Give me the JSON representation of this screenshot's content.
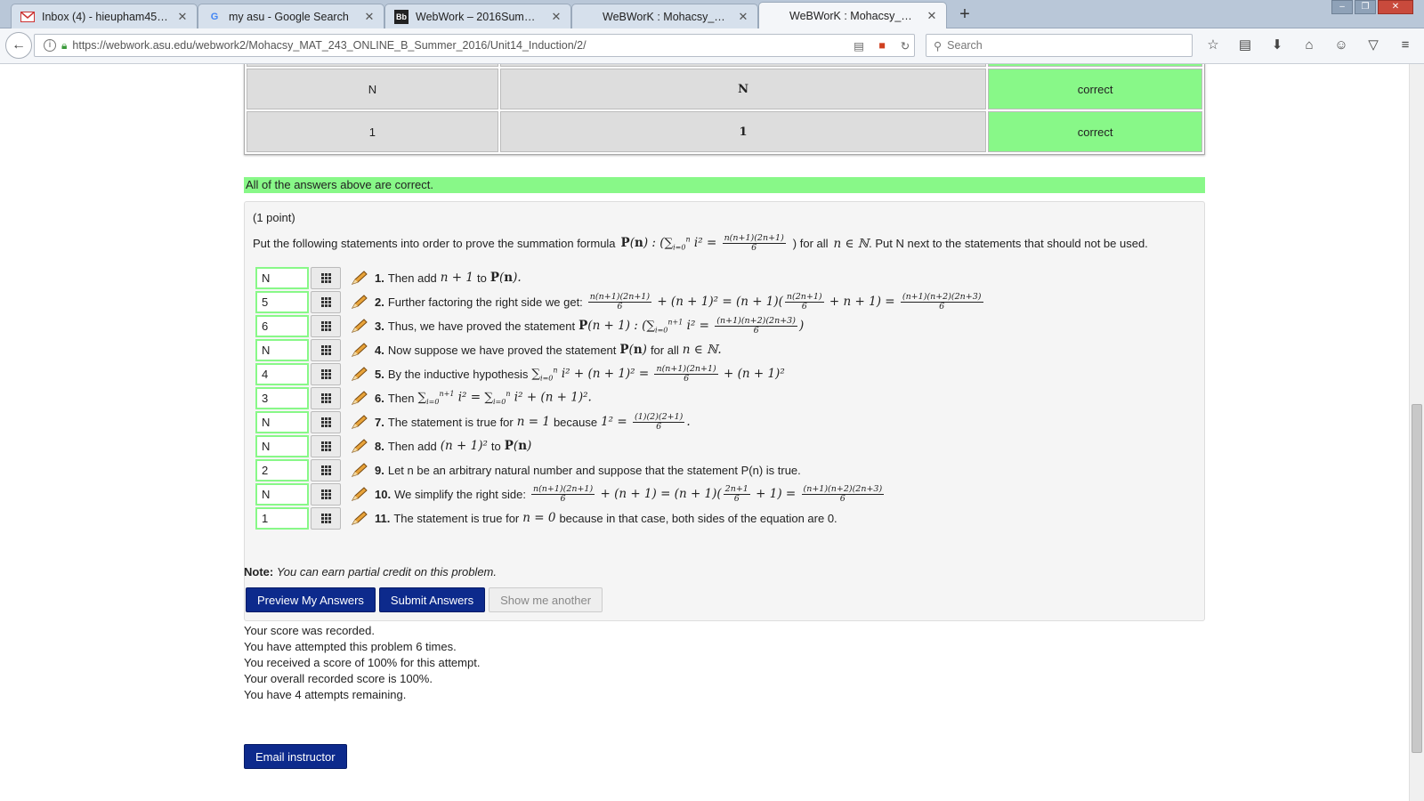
{
  "tabs": [
    {
      "title": "Inbox (4) - hieupham45@g...",
      "favicon": "gmail-icon"
    },
    {
      "title": "my asu - Google Search",
      "favicon": "google-icon"
    },
    {
      "title": "WebWork – 2016SummerB...",
      "favicon": "blackboard-icon"
    },
    {
      "title": "WeBWorK : Mohacsy_MAT...",
      "favicon": "none"
    },
    {
      "title": "WeBWorK : Mohacsy_MAT...",
      "favicon": "none"
    }
  ],
  "active_tab": 4,
  "url": "https://webwork.asu.edu/webwork2/Mohacsy_MAT_243_ONLINE_B_Summer_2016/Unit14_Induction/2/",
  "search_placeholder": "Search",
  "results_table": {
    "rows": [
      {
        "entered": "N",
        "preview": "N",
        "result": "correct"
      },
      {
        "entered": "1",
        "preview": "1",
        "result": "correct"
      }
    ]
  },
  "all_correct_message": "All of the answers above are correct.",
  "problem": {
    "points": "(1 point)",
    "intro_before": "Put the following statements into order to prove the summation formula",
    "intro_after": ") for all",
    "intro_end": ". Put N next to the statements that should not be used.",
    "statements": [
      {
        "num": "1.",
        "answer": "N",
        "text": "Then add n + 1 to P(n)."
      },
      {
        "num": "2.",
        "answer": "5",
        "text": "Further factoring the right side we get:"
      },
      {
        "num": "3.",
        "answer": "6",
        "text": "Thus, we have proved the statement"
      },
      {
        "num": "4.",
        "answer": "N",
        "text": "Now suppose we have proved the statement"
      },
      {
        "num": "5.",
        "answer": "4",
        "text": "By the inductive hypothesis"
      },
      {
        "num": "6.",
        "answer": "3",
        "text": "Then"
      },
      {
        "num": "7.",
        "answer": "N",
        "text": "The statement is true for"
      },
      {
        "num": "8.",
        "answer": "N",
        "text": "Then add"
      },
      {
        "num": "9.",
        "answer": "2",
        "text": "Let n be an arbitrary natural number and suppose that the statement P(n) is true."
      },
      {
        "num": "10.",
        "answer": "N",
        "text": "We simplify the right side:"
      },
      {
        "num": "11.",
        "answer": "1",
        "text": "The statement is true for"
      }
    ]
  },
  "note": {
    "label": "Note:",
    "text": "You can earn partial credit on this problem."
  },
  "buttons": {
    "preview": "Preview My Answers",
    "submit": "Submit Answers",
    "show_another": "Show me another"
  },
  "score_lines": [
    "Your score was recorded.",
    "You have attempted this problem 6 times.",
    "You received a score of 100% for this attempt.",
    "Your overall recorded score is 100%.",
    "You have 4 attempts remaining."
  ],
  "email_button": "Email instructor",
  "colors": {
    "correct": "#88f888",
    "button": "#0d2a8c"
  }
}
